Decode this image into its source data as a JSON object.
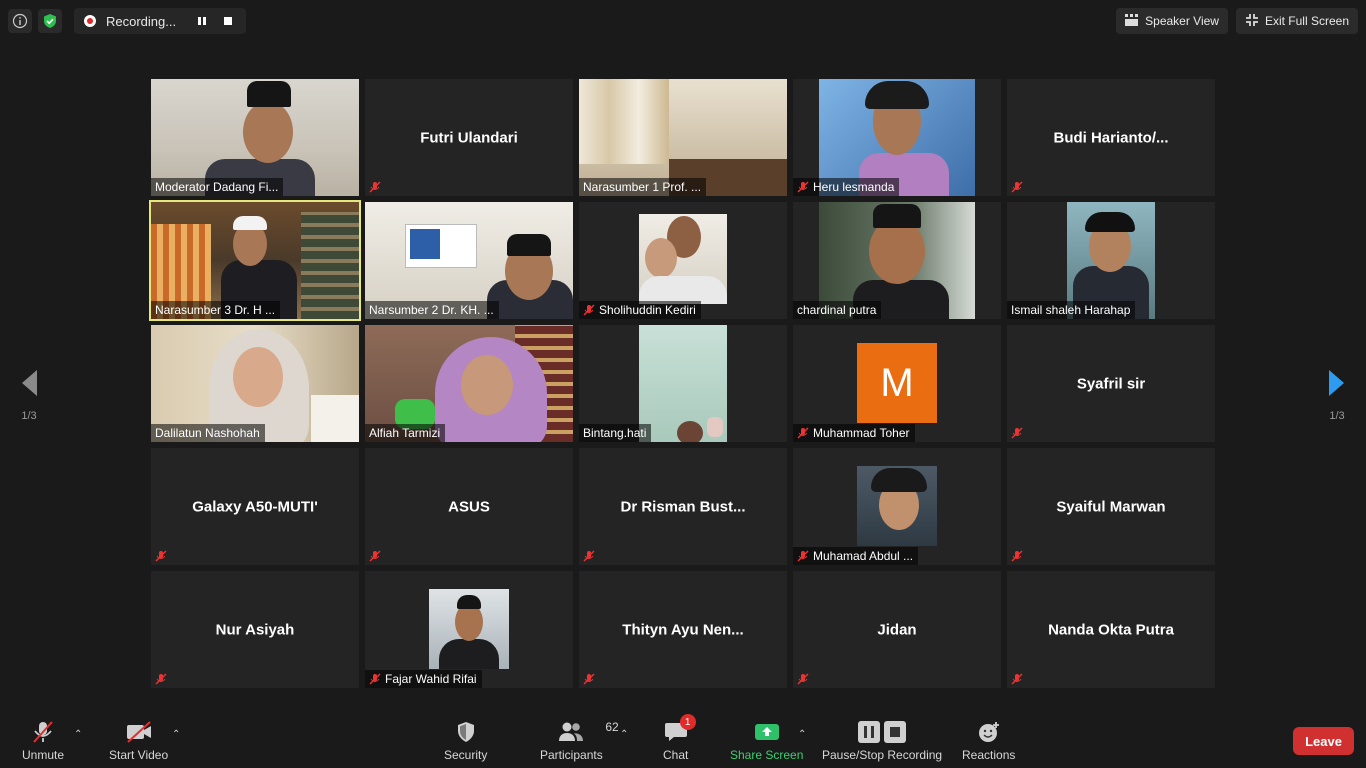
{
  "top": {
    "recording_label": "Recording...",
    "speaker_view_label": "Speaker View",
    "exit_fullscreen_label": "Exit Full Screen"
  },
  "pager": {
    "left": "1/3",
    "right": "1/3"
  },
  "colors": {
    "recording_red": "#e02828",
    "active_speaker": "#e5e77a",
    "share_green": "#3cd070",
    "leave_red": "#d03030",
    "avatar_orange": "#ea6d12"
  },
  "tiles": [
    {
      "label": "Moderator Dadang Fi...",
      "video": true,
      "muted": false
    },
    {
      "name": "Futri Ulandari",
      "video": false,
      "muted": true
    },
    {
      "label": "Narasumber 1 Prof. ...",
      "video": true,
      "muted": false
    },
    {
      "label": "Heru lesmanda",
      "video": true,
      "muted": true
    },
    {
      "name": "Budi  Harianto/...",
      "video": false,
      "muted": true
    },
    {
      "label": "Narasumber 3 Dr. H ...",
      "video": true,
      "muted": false,
      "active": true
    },
    {
      "label": "Narsumber 2 Dr. KH. ...",
      "video": true,
      "muted": false
    },
    {
      "label": "Sholihuddin Kediri",
      "video": true,
      "muted": true
    },
    {
      "label": "chardinal putra",
      "video": true,
      "muted": false
    },
    {
      "label": "Ismail shaleh Harahap",
      "video": true,
      "muted": false
    },
    {
      "label": "Dalilatun Nashohah",
      "video": true,
      "muted": false
    },
    {
      "label": "Alfiah Tarmizi",
      "video": true,
      "muted": false
    },
    {
      "label": "Bintang.hati",
      "video": true,
      "muted": false
    },
    {
      "label": "Muhammad Toher",
      "initial": "M",
      "muted": true
    },
    {
      "name": "Syafril sir",
      "video": false,
      "muted": true
    },
    {
      "name": "Galaxy A50-MUTI'",
      "video": false,
      "muted": true
    },
    {
      "name": "ASUS",
      "video": false,
      "muted": true
    },
    {
      "name": "Dr Risman Bust...",
      "video": false,
      "muted": true
    },
    {
      "label": "Muhamad Abdul ...",
      "photo": true,
      "muted": true
    },
    {
      "name": "Syaiful Marwan",
      "video": false,
      "muted": true
    },
    {
      "name": "Nur Asiyah",
      "video": false,
      "muted": true
    },
    {
      "label": "Fajar Wahid Rifai",
      "photo": true,
      "muted": true
    },
    {
      "name": "Thityn Ayu Nen...",
      "video": false,
      "muted": true
    },
    {
      "name": "Jidan",
      "video": false,
      "muted": true
    },
    {
      "name": "Nanda Okta Putra",
      "video": false,
      "muted": true
    }
  ],
  "toolbar": {
    "unmute": "Unmute",
    "start_video": "Start Video",
    "security": "Security",
    "participants": "Participants",
    "participants_count": "62",
    "chat": "Chat",
    "chat_badge": "1",
    "share_screen": "Share Screen",
    "pause_stop_recording": "Pause/Stop Recording",
    "reactions": "Reactions",
    "leave": "Leave"
  }
}
